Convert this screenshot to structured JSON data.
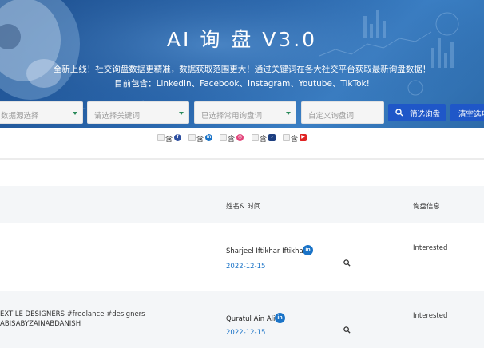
{
  "hero": {
    "title": "AI 询 盘 V3.0",
    "subtitle_line1": "全新上线！社交询盘数据更精准，数据获取范围更大！通过关键词在各大社交平台获取最新询盘数据！",
    "subtitle_line2": "目前包含：LinkedIn、Facebook、Instagram、Youtube、TikTok!"
  },
  "filters": {
    "data_source_placeholder": "数据源选择",
    "keyword_placeholder": "请选择关键词",
    "common_terms_placeholder": "已选择常用询盘词",
    "custom_terms_placeholder": "自定义询盘词",
    "filter_button": "筛选询盘",
    "clear_button": "清空选项"
  },
  "platform_checks": [
    {
      "label": "含",
      "icon": "facebook-icon",
      "color": "#2d4fa0",
      "glyph": "f"
    },
    {
      "label": "含",
      "icon": "linkedin-icon",
      "color": "#1a73c7",
      "glyph": "in"
    },
    {
      "label": "含",
      "icon": "instagram-icon",
      "color": "#e2437a",
      "glyph": "◎"
    },
    {
      "label": "含",
      "icon": "tiktok-icon",
      "color": "#1c3e80",
      "glyph": "♪"
    },
    {
      "label": "含",
      "icon": "youtube-icon",
      "color": "#e02323",
      "glyph": "▶"
    }
  ],
  "table": {
    "headers": {
      "name_time": "姓名& 时间",
      "inquiry_info": "询盘信息"
    },
    "rows": [
      {
        "bio_line1": "",
        "bio_line2": "",
        "name": "Sharjeel Iftikhar Iftikhar",
        "platform": "in",
        "date": "2022-12-15",
        "status": "Interested"
      },
      {
        "bio_line1": "EXTILE DESIGNERS #freelance #designers",
        "bio_line2": "ABISABYZAINABDANISH",
        "name": "Quratul Ain Ali",
        "platform": "in",
        "date": "2022-12-15",
        "status": "Interested"
      }
    ]
  },
  "colors": {
    "hero": "#2a67ad",
    "primary_button": "#1f57c8",
    "link": "#1a73c7"
  }
}
